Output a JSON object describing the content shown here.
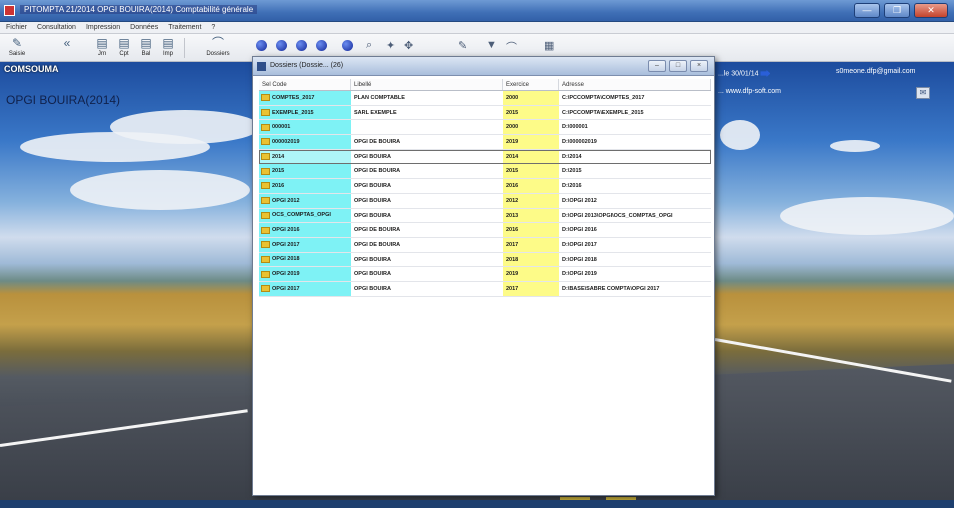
{
  "window": {
    "title": "PITOMPTA 21/2014 OPGI BOUIRA(2014) Comptabilité générale",
    "controls": [
      "—",
      "❐",
      "✕"
    ]
  },
  "menu": [
    "Fichier",
    "Consultation",
    "Impression",
    "Données",
    "Traitement",
    "?"
  ],
  "toolbar": {
    "buttons": [
      {
        "label": "Saisie",
        "icon": "edit-icon"
      },
      {
        "label": "Jrn",
        "icon": "journal-icon"
      },
      {
        "label": "Cpt",
        "icon": "account-icon"
      },
      {
        "label": "Bal",
        "icon": "balance-icon"
      },
      {
        "label": "Imp",
        "icon": "print-icon"
      },
      {
        "label": "Dossiers",
        "icon": "folder-icon"
      }
    ]
  },
  "desktop": {
    "company": "COMSOUMA",
    "current_folder": "OPGI BOUIRA(2014)",
    "info_line1": "...le 30/01/14",
    "info_line2": "... www.dfp-soft.com",
    "email": "s0meone.dfp@gmail.com"
  },
  "dialog": {
    "title": "Dossiers (Dossie... (26)",
    "columns": [
      "Sel Code",
      "Libellé",
      "Exercice",
      "Adresse"
    ],
    "rows": [
      {
        "code": "COMPTES_2017",
        "label": "PLAN COMPTABLE",
        "year": "2000",
        "address": "C:\\PCCOMPTA\\COMPTES_2017"
      },
      {
        "code": "EXEMPLE_2015",
        "label": "SARL EXEMPLE",
        "year": "2015",
        "address": "C:\\PCCOMPTA\\EXEMPLE_2015"
      },
      {
        "code": "000001",
        "label": "",
        "year": "2000",
        "address": "D:\\000001"
      },
      {
        "code": "000002019",
        "label": "OPGI DE BOUIRA",
        "year": "2019",
        "address": "D:\\000002019"
      },
      {
        "code": "2014",
        "label": "OPGI BOUIRA",
        "year": "2014",
        "address": "D:\\2014",
        "selected": true
      },
      {
        "code": "2015",
        "label": "OPGI DE BOUIRA",
        "year": "2015",
        "address": "D:\\2015"
      },
      {
        "code": "2016",
        "label": "OPGI BOUIRA",
        "year": "2016",
        "address": "D:\\2016"
      },
      {
        "code": "OPGI 2012",
        "label": "OPGI BOUIRA",
        "year": "2012",
        "address": "D:\\OPGI 2012"
      },
      {
        "code": "OCS_COMPTAS_OPGI",
        "label": "OPGI BOUIRA",
        "year": "2013",
        "address": "D:\\OPGI 2013\\OPGI\\OCS_COMPTAS_OPGI"
      },
      {
        "code": "OPGI 2016",
        "label": "OPGI DE BOUIRA",
        "year": "2016",
        "address": "D:\\OPGI 2016"
      },
      {
        "code": "OPGI 2017",
        "label": "OPGI DE BOUIRA",
        "year": "2017",
        "address": "D:\\OPGI 2017"
      },
      {
        "code": "OPGI 2018",
        "label": "OPGI BOUIRA",
        "year": "2018",
        "address": "D:\\OPGI 2018"
      },
      {
        "code": "OPGI 2019",
        "label": "OPGI BOUIRA",
        "year": "2019",
        "address": "D:\\OPGI 2019"
      },
      {
        "code": "OPGI 2017",
        "label": "OPGI BOUIRA",
        "year": "2017",
        "address": "D:\\BASE\\SABRE COMPTA\\OPGI 2017"
      }
    ]
  },
  "colors": {
    "code_column": "#7ef2f5",
    "year_column": "#fdfb88",
    "titlebar": "#3f6fb6"
  }
}
